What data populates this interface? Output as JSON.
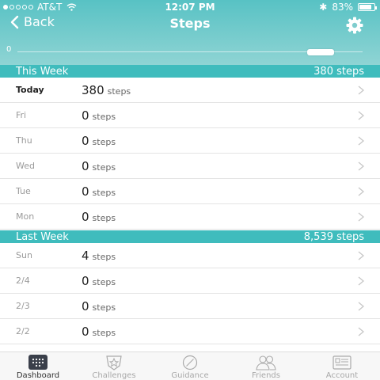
{
  "statusbar": {
    "carrier": "AT&T",
    "time": "12:07 PM",
    "battery": "83%",
    "battery_level": 0.83
  },
  "nav": {
    "back_label": "Back",
    "title": "Steps"
  },
  "slider": {
    "label": "0"
  },
  "this_week": {
    "title": "This Week",
    "total": "380 steps",
    "rows": [
      {
        "day": "Today",
        "value": "380",
        "unit": "steps"
      },
      {
        "day": "Fri",
        "value": "0",
        "unit": "steps"
      },
      {
        "day": "Thu",
        "value": "0",
        "unit": "steps"
      },
      {
        "day": "Wed",
        "value": "0",
        "unit": "steps"
      },
      {
        "day": "Tue",
        "value": "0",
        "unit": "steps"
      },
      {
        "day": "Mon",
        "value": "0",
        "unit": "steps"
      }
    ]
  },
  "last_week": {
    "title": "Last Week",
    "total": "8,539 steps",
    "rows": [
      {
        "day": "Sun",
        "value": "4",
        "unit": "steps"
      },
      {
        "day": "2/4",
        "value": "0",
        "unit": "steps"
      },
      {
        "day": "2/3",
        "value": "0",
        "unit": "steps"
      },
      {
        "day": "2/2",
        "value": "0",
        "unit": "steps"
      }
    ]
  },
  "tabs": [
    {
      "label": "Dashboard",
      "icon": "dashboard-icon",
      "active": true
    },
    {
      "label": "Challenges",
      "icon": "challenges-icon",
      "active": false
    },
    {
      "label": "Guidance",
      "icon": "compass-icon",
      "active": false
    },
    {
      "label": "Friends",
      "icon": "friends-icon",
      "active": false
    },
    {
      "label": "Account",
      "icon": "account-card-icon",
      "active": false
    }
  ],
  "colors": {
    "header_top": "#58c2c4",
    "section": "#3fbcbd"
  }
}
